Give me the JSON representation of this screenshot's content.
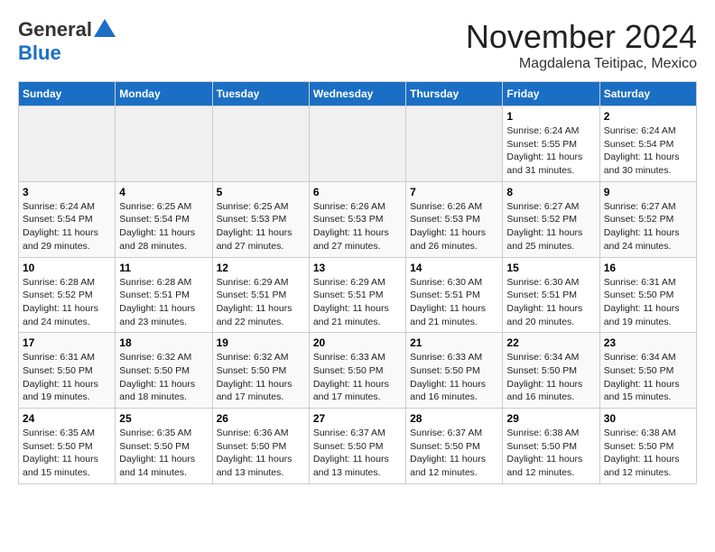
{
  "logo": {
    "general": "General",
    "blue": "Blue"
  },
  "title": "November 2024",
  "location": "Magdalena Teitipac, Mexico",
  "days_of_week": [
    "Sunday",
    "Monday",
    "Tuesday",
    "Wednesday",
    "Thursday",
    "Friday",
    "Saturday"
  ],
  "weeks": [
    {
      "days": [
        {
          "num": "",
          "empty": true
        },
        {
          "num": "",
          "empty": true
        },
        {
          "num": "",
          "empty": true
        },
        {
          "num": "",
          "empty": true
        },
        {
          "num": "",
          "empty": true
        },
        {
          "num": "1",
          "sunrise": "6:24 AM",
          "sunset": "5:55 PM",
          "daylight": "11 hours and 31 minutes."
        },
        {
          "num": "2",
          "sunrise": "6:24 AM",
          "sunset": "5:54 PM",
          "daylight": "11 hours and 30 minutes."
        }
      ]
    },
    {
      "days": [
        {
          "num": "3",
          "sunrise": "6:24 AM",
          "sunset": "5:54 PM",
          "daylight": "11 hours and 29 minutes."
        },
        {
          "num": "4",
          "sunrise": "6:25 AM",
          "sunset": "5:54 PM",
          "daylight": "11 hours and 28 minutes."
        },
        {
          "num": "5",
          "sunrise": "6:25 AM",
          "sunset": "5:53 PM",
          "daylight": "11 hours and 27 minutes."
        },
        {
          "num": "6",
          "sunrise": "6:26 AM",
          "sunset": "5:53 PM",
          "daylight": "11 hours and 27 minutes."
        },
        {
          "num": "7",
          "sunrise": "6:26 AM",
          "sunset": "5:53 PM",
          "daylight": "11 hours and 26 minutes."
        },
        {
          "num": "8",
          "sunrise": "6:27 AM",
          "sunset": "5:52 PM",
          "daylight": "11 hours and 25 minutes."
        },
        {
          "num": "9",
          "sunrise": "6:27 AM",
          "sunset": "5:52 PM",
          "daylight": "11 hours and 24 minutes."
        }
      ]
    },
    {
      "days": [
        {
          "num": "10",
          "sunrise": "6:28 AM",
          "sunset": "5:52 PM",
          "daylight": "11 hours and 24 minutes."
        },
        {
          "num": "11",
          "sunrise": "6:28 AM",
          "sunset": "5:51 PM",
          "daylight": "11 hours and 23 minutes."
        },
        {
          "num": "12",
          "sunrise": "6:29 AM",
          "sunset": "5:51 PM",
          "daylight": "11 hours and 22 minutes."
        },
        {
          "num": "13",
          "sunrise": "6:29 AM",
          "sunset": "5:51 PM",
          "daylight": "11 hours and 21 minutes."
        },
        {
          "num": "14",
          "sunrise": "6:30 AM",
          "sunset": "5:51 PM",
          "daylight": "11 hours and 21 minutes."
        },
        {
          "num": "15",
          "sunrise": "6:30 AM",
          "sunset": "5:51 PM",
          "daylight": "11 hours and 20 minutes."
        },
        {
          "num": "16",
          "sunrise": "6:31 AM",
          "sunset": "5:50 PM",
          "daylight": "11 hours and 19 minutes."
        }
      ]
    },
    {
      "days": [
        {
          "num": "17",
          "sunrise": "6:31 AM",
          "sunset": "5:50 PM",
          "daylight": "11 hours and 19 minutes."
        },
        {
          "num": "18",
          "sunrise": "6:32 AM",
          "sunset": "5:50 PM",
          "daylight": "11 hours and 18 minutes."
        },
        {
          "num": "19",
          "sunrise": "6:32 AM",
          "sunset": "5:50 PM",
          "daylight": "11 hours and 17 minutes."
        },
        {
          "num": "20",
          "sunrise": "6:33 AM",
          "sunset": "5:50 PM",
          "daylight": "11 hours and 17 minutes."
        },
        {
          "num": "21",
          "sunrise": "6:33 AM",
          "sunset": "5:50 PM",
          "daylight": "11 hours and 16 minutes."
        },
        {
          "num": "22",
          "sunrise": "6:34 AM",
          "sunset": "5:50 PM",
          "daylight": "11 hours and 16 minutes."
        },
        {
          "num": "23",
          "sunrise": "6:34 AM",
          "sunset": "5:50 PM",
          "daylight": "11 hours and 15 minutes."
        }
      ]
    },
    {
      "days": [
        {
          "num": "24",
          "sunrise": "6:35 AM",
          "sunset": "5:50 PM",
          "daylight": "11 hours and 15 minutes."
        },
        {
          "num": "25",
          "sunrise": "6:35 AM",
          "sunset": "5:50 PM",
          "daylight": "11 hours and 14 minutes."
        },
        {
          "num": "26",
          "sunrise": "6:36 AM",
          "sunset": "5:50 PM",
          "daylight": "11 hours and 13 minutes."
        },
        {
          "num": "27",
          "sunrise": "6:37 AM",
          "sunset": "5:50 PM",
          "daylight": "11 hours and 13 minutes."
        },
        {
          "num": "28",
          "sunrise": "6:37 AM",
          "sunset": "5:50 PM",
          "daylight": "11 hours and 12 minutes."
        },
        {
          "num": "29",
          "sunrise": "6:38 AM",
          "sunset": "5:50 PM",
          "daylight": "11 hours and 12 minutes."
        },
        {
          "num": "30",
          "sunrise": "6:38 AM",
          "sunset": "5:50 PM",
          "daylight": "11 hours and 12 minutes."
        }
      ]
    }
  ]
}
